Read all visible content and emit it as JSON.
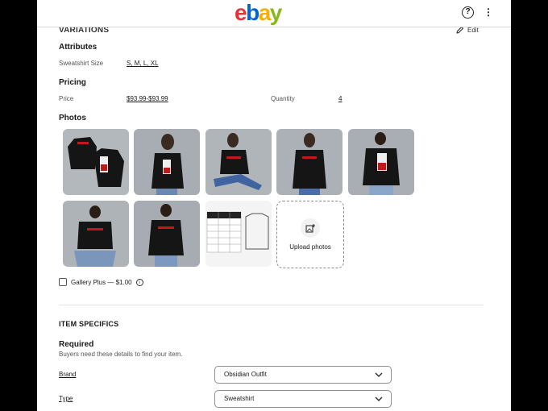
{
  "header": {
    "logo": [
      "e",
      "b",
      "a",
      "y"
    ],
    "help_label": "?",
    "menu_label": "⋮"
  },
  "variations": {
    "title": "VARIATIONS",
    "edit_label": "Edit",
    "attributes": {
      "heading": "Attributes",
      "size_label": "Sweatshirt Size",
      "size_value": "S, M, L, XL"
    },
    "pricing": {
      "heading": "Pricing",
      "price_label": "Price",
      "price_value": "$93.99-$93.99",
      "quantity_label": "Quantity",
      "quantity_value": "4"
    },
    "photos": {
      "heading": "Photos",
      "upload_label": "Upload photos",
      "gallery_plus_label": "Gallery Plus — $1.00"
    }
  },
  "item_specifics": {
    "title": "ITEM SPECIFICS",
    "required_heading": "Required",
    "required_subtitle": "Buyers need these details to find your item.",
    "brand_label": "Brand",
    "brand_value": "Obsidian Outfit",
    "type_label": "Type",
    "type_value": "Sweatshirt"
  },
  "colors": {
    "logo_e": "#e53238",
    "logo_b": "#0064d2",
    "logo_a": "#f5af02",
    "logo_y": "#86b817",
    "shirt": "#141414",
    "print_red": "#c21a1a"
  }
}
